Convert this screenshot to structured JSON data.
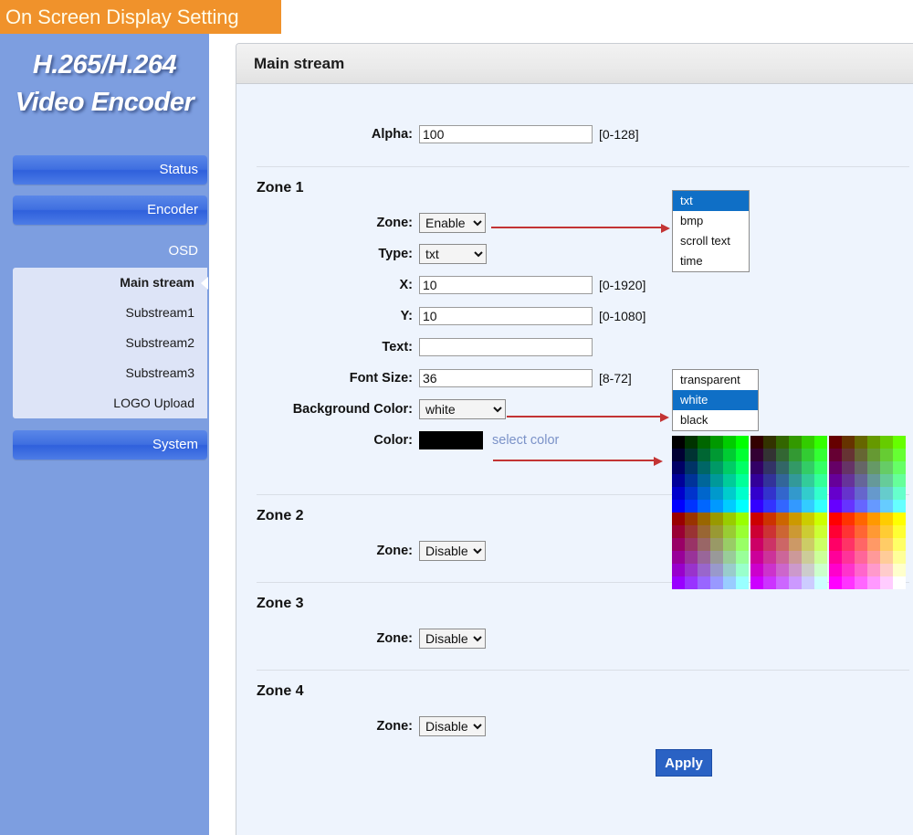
{
  "banner": {
    "title": "On Screen Display Setting"
  },
  "logo": {
    "line1": "H.265/H.264",
    "line2": "Video Encoder"
  },
  "sidebar": {
    "items": [
      {
        "label": "Status",
        "type": "button",
        "active": false
      },
      {
        "label": "Encoder",
        "type": "button",
        "active": false
      },
      {
        "label": "OSD",
        "type": "plain",
        "active": true
      },
      {
        "label": "System",
        "type": "button",
        "active": false
      }
    ],
    "submenu": [
      {
        "label": "Main stream",
        "active": true
      },
      {
        "label": "Substream1",
        "active": false
      },
      {
        "label": "Substream2",
        "active": false
      },
      {
        "label": "Substream3",
        "active": false
      },
      {
        "label": "LOGO Upload",
        "active": false
      }
    ]
  },
  "panel": {
    "header": "Main stream",
    "alpha": {
      "label": "Alpha:",
      "value": "100",
      "hint": "[0-128]"
    },
    "zones": [
      {
        "title": "Zone 1",
        "fields": {
          "zone": {
            "label": "Zone:",
            "value": "Enable",
            "options": [
              "Enable",
              "Disable"
            ]
          },
          "type": {
            "label": "Type:",
            "value": "txt",
            "options": [
              "txt",
              "bmp",
              "scroll text",
              "time"
            ]
          },
          "x": {
            "label": "X:",
            "value": "10",
            "hint": "[0-1920]"
          },
          "y": {
            "label": "Y:",
            "value": "10",
            "hint": "[0-1080]"
          },
          "text": {
            "label": "Text:",
            "value": "",
            "placeholder": ""
          },
          "font_size": {
            "label": "Font Size:",
            "value": "36",
            "hint": "[8-72]"
          },
          "background_color": {
            "label": "Background Color:",
            "value": "white",
            "options": [
              "transparent",
              "white",
              "black"
            ]
          },
          "color": {
            "label": "Color:",
            "swatch": "#000000",
            "link": "select color"
          }
        }
      },
      {
        "title": "Zone 2",
        "zone": {
          "label": "Zone:",
          "value": "Disable",
          "options": [
            "Enable",
            "Disable"
          ]
        }
      },
      {
        "title": "Zone 3",
        "zone": {
          "label": "Zone:",
          "value": "Disable",
          "options": [
            "Enable",
            "Disable"
          ]
        }
      },
      {
        "title": "Zone 4",
        "zone": {
          "label": "Zone:",
          "value": "Disable",
          "options": [
            "Enable",
            "Disable"
          ]
        }
      }
    ],
    "apply_label": "Apply"
  },
  "popups": {
    "type_list": {
      "options": [
        "txt",
        "bmp",
        "scroll text",
        "time"
      ],
      "selected": "txt"
    },
    "bgcolor_list": {
      "options": [
        "transparent",
        "white",
        "black"
      ],
      "selected": "white"
    }
  },
  "color_picker": {
    "name": "websafe-palette",
    "red_levels": [
      0,
      51,
      102,
      153,
      204,
      255
    ],
    "green_levels": [
      0,
      51,
      102,
      153,
      204,
      255
    ],
    "blue_levels": [
      0,
      51,
      102,
      153,
      204,
      255
    ],
    "blocks_per_row": 3,
    "rows": 2
  },
  "colors": {
    "banner_orange": "#f0922b",
    "sidebar_blue": "#7d9ee0",
    "nav_button_blue": "#3f6fe0",
    "submenu_bg": "#dde4f7",
    "panel_bg": "#eef4fd",
    "apply_blue": "#2a62c4",
    "arrow_red": "#c33434",
    "link_blue": "#7b92c8",
    "popup_selected": "#0f6fc6"
  }
}
